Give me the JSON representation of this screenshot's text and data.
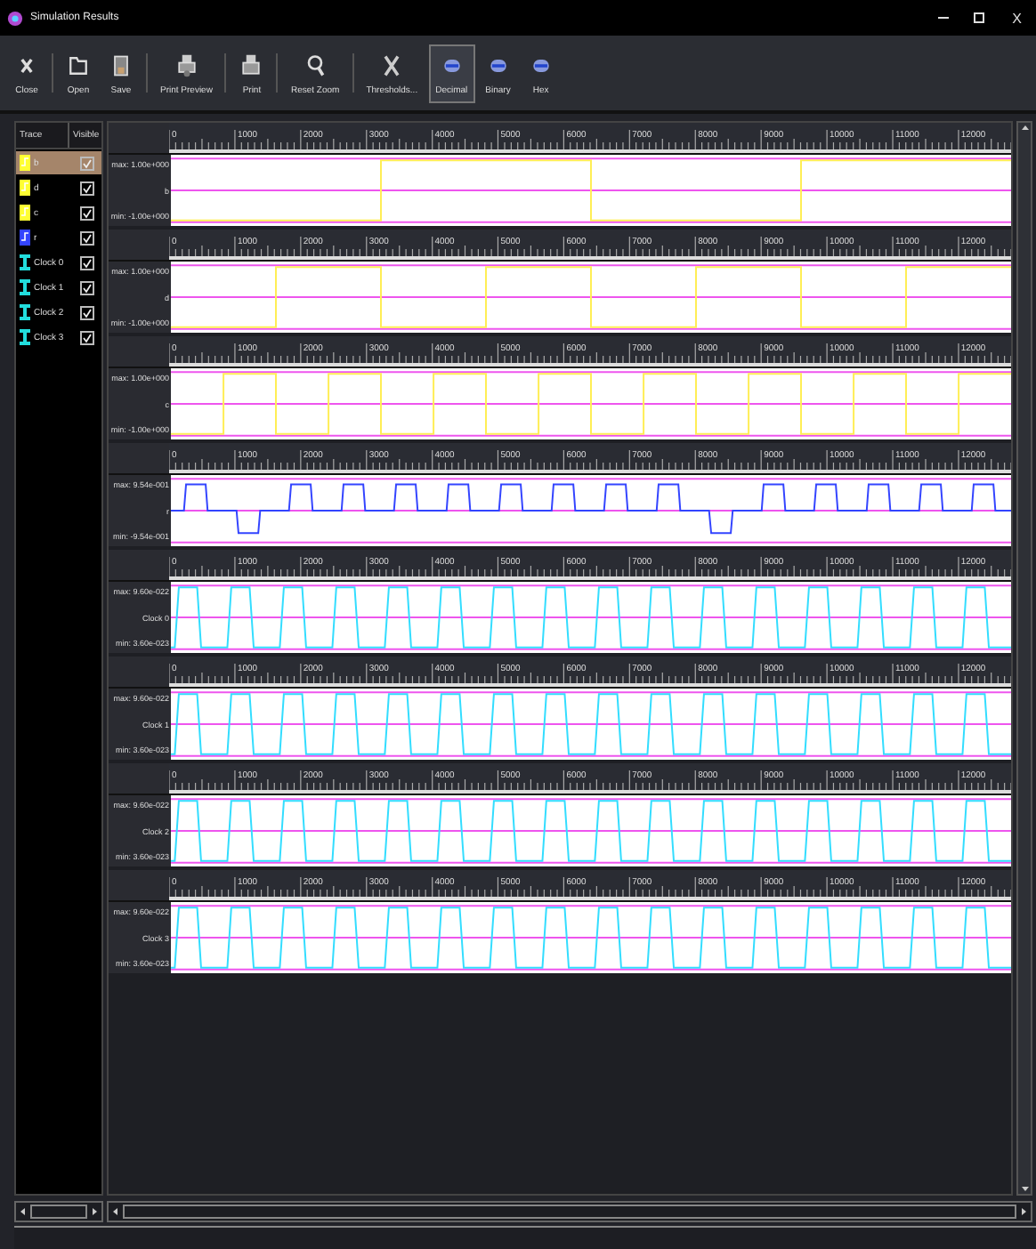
{
  "window": {
    "title": "Simulation Results",
    "close": "X"
  },
  "toolbar": [
    {
      "label": "Close",
      "kind": "close",
      "selected": false
    },
    {
      "label": "Open",
      "kind": "open",
      "selected": false
    },
    {
      "label": "Save",
      "kind": "save",
      "selected": false
    },
    {
      "label": "Print Preview",
      "kind": "preview",
      "selected": false
    },
    {
      "label": "Print",
      "kind": "print",
      "selected": false
    },
    {
      "label": "Reset Zoom",
      "kind": "zoom",
      "selected": false
    },
    {
      "label": "Thresholds...",
      "kind": "tools",
      "selected": false
    },
    {
      "label": "Decimal",
      "kind": "format",
      "selected": true
    },
    {
      "label": "Binary",
      "kind": "format",
      "selected": false
    },
    {
      "label": "Hex",
      "kind": "format",
      "selected": false
    }
  ],
  "trace_list": {
    "columns": [
      "Trace",
      "Visible"
    ],
    "rows": [
      {
        "name": "b",
        "kind": "signal",
        "color": "#ffff33",
        "visible": true,
        "selected": true
      },
      {
        "name": "d",
        "kind": "signal",
        "color": "#ffff33",
        "visible": true,
        "selected": false
      },
      {
        "name": "c",
        "kind": "signal",
        "color": "#ffff33",
        "visible": true,
        "selected": false
      },
      {
        "name": "r",
        "kind": "signal",
        "color": "#3344ff",
        "visible": true,
        "selected": false
      },
      {
        "name": "Clock 0",
        "kind": "clock",
        "color": "#22dddd",
        "visible": true,
        "selected": false
      },
      {
        "name": "Clock 1",
        "kind": "clock",
        "color": "#22dddd",
        "visible": true,
        "selected": false
      },
      {
        "name": "Clock 2",
        "kind": "clock",
        "color": "#22dddd",
        "visible": true,
        "selected": false
      },
      {
        "name": "Clock 3",
        "kind": "clock",
        "color": "#22dddd",
        "visible": true,
        "selected": false
      }
    ]
  },
  "plots": [
    {
      "name": "b",
      "max": "max: 1.00e+000",
      "min": "min: -1.00e+000",
      "kind": "digital",
      "color": "#ffee55",
      "ruler_labels": [
        "0",
        "1000",
        "2000",
        "3000",
        "4000",
        "5000",
        "6000",
        "7000",
        "8000",
        "9000",
        "10000",
        "11000",
        "12000"
      ]
    },
    {
      "name": "d",
      "max": "max: 1.00e+000",
      "min": "min: -1.00e+000",
      "kind": "digital",
      "color": "#ffee55",
      "ruler_labels": [
        "0",
        "1000",
        "2000",
        "3000",
        "4000",
        "5000",
        "6000",
        "7000",
        "8000",
        "9000",
        "10000",
        "11000",
        "12000"
      ]
    },
    {
      "name": "c",
      "max": "max: 1.00e+000",
      "min": "min: -1.00e+000",
      "kind": "digital",
      "color": "#ffee55",
      "ruler_labels": [
        "0",
        "1000",
        "2000",
        "3000",
        "4000",
        "5000",
        "6000",
        "7000",
        "8000",
        "9000",
        "10000",
        "11000",
        "12000"
      ]
    },
    {
      "name": "r",
      "max": "max: 9.54e-001",
      "min": "min: -9.54e-001",
      "kind": "analog",
      "color": "#3344ff",
      "ruler_labels": [
        "0",
        "1000",
        "2000",
        "3000",
        "4000",
        "5000",
        "6000",
        "7000",
        "8000",
        "9000",
        "10000",
        "11000",
        "12000"
      ]
    },
    {
      "name": "Clock 0",
      "max": "max: 9.60e-022",
      "min": "min: 3.60e-023",
      "kind": "clock",
      "color": "#33ddff",
      "ruler_labels": [
        "0",
        "1000",
        "2000",
        "3000",
        "4000",
        "5000",
        "6000",
        "7000",
        "8000",
        "9000",
        "10000",
        "11000",
        "12000"
      ]
    },
    {
      "name": "Clock 1",
      "max": "max: 9.60e-022",
      "min": "min: 3.60e-023",
      "kind": "clock",
      "color": "#33ddff",
      "ruler_labels": [
        "0",
        "1000",
        "2000",
        "3000",
        "4000",
        "5000",
        "6000",
        "7000",
        "8000",
        "9000",
        "10000",
        "11000",
        "12000"
      ]
    },
    {
      "name": "Clock 2",
      "max": "max: 9.60e-022",
      "min": "min: 3.60e-023",
      "kind": "clock",
      "color": "#33ddff",
      "ruler_labels": [
        "0",
        "1000",
        "2000",
        "3000",
        "4000",
        "5000",
        "6000",
        "7000",
        "8000",
        "9000",
        "10000",
        "11000",
        "12000"
      ]
    },
    {
      "name": "Clock 3",
      "max": "max: 9.60e-022",
      "min": "min: 3.60e-023",
      "kind": "clock",
      "color": "#33ddff",
      "ruler_labels": [
        "0",
        "1000",
        "2000",
        "3000",
        "4000",
        "5000",
        "6000",
        "7000",
        "8000",
        "9000",
        "10000",
        "11000",
        "12000"
      ]
    }
  ]
}
